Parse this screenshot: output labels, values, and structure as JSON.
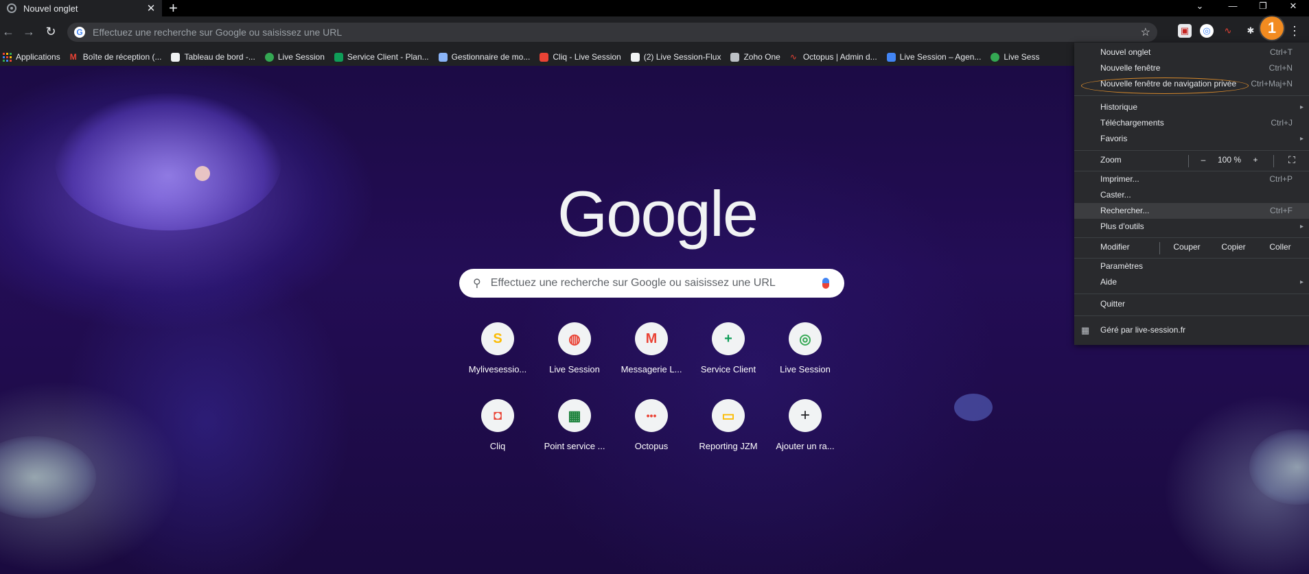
{
  "tab": {
    "title": "Nouvel onglet",
    "close": "✕",
    "new": "+"
  },
  "window": {
    "minimize": "—",
    "restore": "❐",
    "close": "✕",
    "tabsearch": "⌄"
  },
  "toolbar": {
    "back": "←",
    "forward": "→",
    "reload": "↻",
    "omnibox_placeholder": "Effectuez une recherche sur Google ou saisissez une URL",
    "star": "☆",
    "extensions": "✱",
    "menu": "⋮"
  },
  "bookmarks": [
    {
      "label": "Applications",
      "color": "#ea4335"
    },
    {
      "label": "Boîte de réception (...",
      "color": "#ea4335"
    },
    {
      "label": "Tableau de bord -...",
      "color": "#f1f3f4"
    },
    {
      "label": "Live Session",
      "color": "#34a853"
    },
    {
      "label": "Service Client - Plan...",
      "color": "#0f9d58"
    },
    {
      "label": "Gestionnaire de mo...",
      "color": "#8ab4f8"
    },
    {
      "label": "Cliq - Live Session",
      "color": "#ea4335"
    },
    {
      "label": "(2) Live Session-Flux",
      "color": "#f1f3f4"
    },
    {
      "label": "Zoho One",
      "color": "#bdc1c6"
    },
    {
      "label": "Octopus | Admin d...",
      "color": "#ea4335"
    },
    {
      "label": "Live Session – Agen...",
      "color": "#4285f4"
    },
    {
      "label": "Live Sess",
      "color": "#34a853"
    }
  ],
  "google": {
    "logo": "Google",
    "search_placeholder": "Effectuez une recherche sur Google ou saisissez une URL"
  },
  "shortcuts": [
    {
      "label": "Mylivesessio...",
      "glyph": "S",
      "color": "#fbbc05"
    },
    {
      "label": "Live Session",
      "glyph": "◍",
      "color": "#ea4335"
    },
    {
      "label": "Messagerie L...",
      "glyph": "M",
      "color": "#ea4335"
    },
    {
      "label": "Service Client",
      "glyph": "+",
      "color": "#0f9d58"
    },
    {
      "label": "Live Session",
      "glyph": "◎",
      "color": "#34a853"
    },
    {
      "label": "Cliq",
      "glyph": "◘",
      "color": "#ea4335"
    },
    {
      "label": "Point service ...",
      "glyph": "▦",
      "color": "#188038"
    },
    {
      "label": "Octopus",
      "glyph": "•••",
      "color": "#ea4335"
    },
    {
      "label": "Reporting JZM",
      "glyph": "▭",
      "color": "#fbbc05"
    },
    {
      "label": "Ajouter un ra...",
      "glyph": "+",
      "color": "#202124"
    }
  ],
  "menu": {
    "new_tab": "Nouvel onglet",
    "new_tab_sc": "Ctrl+T",
    "new_window": "Nouvelle fenêtre",
    "new_window_sc": "Ctrl+N",
    "incognito": "Nouvelle fenêtre de navigation privée",
    "incognito_sc": "Ctrl+Maj+N",
    "history": "Historique",
    "downloads": "Téléchargements",
    "downloads_sc": "Ctrl+J",
    "favorites": "Favoris",
    "zoom": "Zoom",
    "zoom_minus": "–",
    "zoom_value": "100 %",
    "zoom_plus": "+",
    "fullscreen": "⛶",
    "print": "Imprimer...",
    "print_sc": "Ctrl+P",
    "cast": "Caster...",
    "find": "Rechercher...",
    "find_sc": "Ctrl+F",
    "more_tools": "Plus d'outils",
    "edit": "Modifier",
    "cut": "Couper",
    "copy": "Copier",
    "paste": "Coller",
    "settings": "Paramètres",
    "help": "Aide",
    "quit": "Quitter",
    "managed": "Géré par live-session.fr",
    "arrow": "▸"
  },
  "step_badge": "1"
}
